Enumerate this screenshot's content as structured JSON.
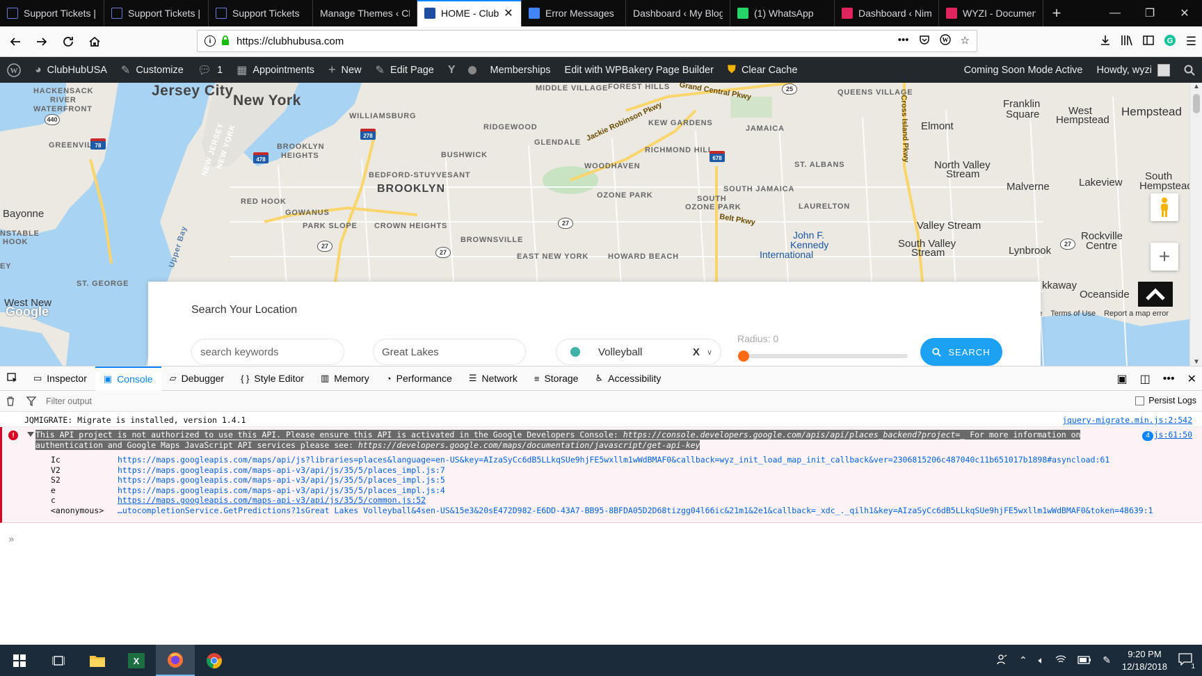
{
  "browser": {
    "tabs": [
      {
        "label": "Support Tickets |",
        "icon": "table-icon",
        "color": "#6b7bd6"
      },
      {
        "label": "Support Tickets |",
        "icon": "table-icon",
        "color": "#6b7bd6"
      },
      {
        "label": "Support Tickets",
        "icon": "table-icon",
        "color": "#6b7bd6"
      },
      {
        "label": "Manage Themes ‹ Cl",
        "icon": "",
        "color": ""
      },
      {
        "label": "HOME - Club",
        "icon": "clubhub-icon",
        "color": "#1d4ea0",
        "active": true
      },
      {
        "label": "Error Messages",
        "icon": "google-icon",
        "color": "#4285f4"
      },
      {
        "label": "Dashboard ‹ My Blog",
        "icon": "",
        "color": ""
      },
      {
        "label": "(1) WhatsApp",
        "icon": "whatsapp-icon",
        "color": "#25d366"
      },
      {
        "label": "Dashboard ‹ Nim",
        "icon": "wyzi-icon",
        "color": "#e0245e"
      },
      {
        "label": "WYZI - Documen",
        "icon": "wyzi-icon",
        "color": "#e0245e"
      }
    ],
    "new_tab": "+",
    "window": {
      "minimize": "—",
      "restore": "❐",
      "close": "✕"
    },
    "url": "https://clubhubusa.com"
  },
  "wp_admin": {
    "site": "ClubHubUSA",
    "customize": "Customize",
    "comments": "1",
    "appointments": "Appointments",
    "new": "New",
    "edit_page": "Edit Page",
    "memberships": "Memberships",
    "wpbakery": "Edit with WPBakery Page Builder",
    "clear_cache": "Clear Cache",
    "coming_soon": "Coming Soon Mode Active",
    "howdy": "Howdy, wyzi"
  },
  "map": {
    "labels": {
      "jersey_city": "Jersey City",
      "new_york": "New York",
      "brooklyn": "BROOKLYN",
      "hackensack": "HACKENSACK",
      "river": "RIVER",
      "waterfront": "WATERFRONT",
      "greenville": "GREENVILLE",
      "williamsburg": "WILLIAMSBURG",
      "ridgewood": "RIDGEWOOD",
      "glendale": "GLENDALE",
      "bushwick": "BUSHWICK",
      "brooklyn_heights": "BROOKLYN",
      "heights": "HEIGHTS",
      "bed_stuy": "BEDFORD-STUYVESANT",
      "red_hook": "RED HOOK",
      "gowanus": "GOWANUS",
      "park_slope": "PARK SLOPE",
      "crown_heights": "CROWN HEIGHTS",
      "brownsville": "BROWNSVILLE",
      "east_new_york": "EAST NEW YORK",
      "howard_beach": "HOWARD BEACH",
      "ozone_park": "OZONE PARK",
      "south_ozone_park": "SOUTH",
      "south_ozone_park2": "OZONE PARK",
      "woodhaven": "WOODHAVEN",
      "richmond_hill": "RICHMOND HILL",
      "kew_gardens": "KEW GARDENS",
      "forest_hills": "FOREST HILLS",
      "middle_village": "MIDDLE VILLAGE",
      "queens_village": "QUEENS VILLAGE",
      "jamaica": "JAMAICA",
      "st_albans": "ST. ALBANS",
      "south_jamaica": "SOUTH JAMAICA",
      "laurelton": "LAURELTON",
      "franklin_square": "Franklin",
      "franklin_square2": "Square",
      "elmont": "Elmont",
      "west_hempstead": "West",
      "west_hempstead2": "Hempstead",
      "hempstead": "Hempstead",
      "north_valley_stream": "North Valley",
      "north_valley_stream2": "Stream",
      "malverne": "Malverne",
      "lakeview": "Lakeview",
      "south_hempstead": "South",
      "south_hempstead2": "Hempstead",
      "valley_stream": "Valley Stream",
      "south_valley_stream": "South Valley",
      "south_valley_stream2": "Stream",
      "lynbrook": "Lynbrook",
      "rockville_centre": "Rockville",
      "rockville_centre2": "Centre",
      "oceanside": "Oceanside",
      "kaway": "kkaway",
      "bayonne": "Bayonne",
      "constable": "NSTABLE",
      "hook": "HOOK",
      "st_george": "ST. GEORGE",
      "west_new": "West New",
      "jfk1": "John F.",
      "jfk2": "Kennedy",
      "jfk3": "International",
      "upper_bay": "Upper Bay",
      "nj_label": "NEW JERSEY",
      "ny_label": "NEW YORK",
      "grand_central": "Grand Central Pkwy",
      "jackie_robinson": "Jackie Robinson Pkwy",
      "belt_pkwy": "Belt Pkwy",
      "cross_island": "Cross Island Pkwy",
      "ey": "EY"
    },
    "shields": {
      "s440": "440",
      "s78": "78",
      "s278": "278",
      "s478": "478",
      "s678": "678",
      "s25": "25",
      "s27a": "27",
      "s27b": "27",
      "s27c": "27",
      "s27d": "27"
    },
    "footer": {
      "e": "e",
      "terms": "Terms of Use",
      "report": "Report a map error"
    },
    "google": "Google"
  },
  "search": {
    "title": "Search Your Location",
    "keywords_placeholder": "search keywords",
    "location_value": "Great Lakes",
    "category_value": "Volleyball",
    "category_clear": "X",
    "radius_label": "Radius: 0",
    "radius_value": 0,
    "button": "SEARCH"
  },
  "devtools": {
    "tabs": [
      "Inspector",
      "Console",
      "Debugger",
      "Style Editor",
      "Memory",
      "Performance",
      "Network",
      "Storage",
      "Accessibility"
    ],
    "active_tab": "Console",
    "filter_placeholder": "Filter output",
    "persist_logs": "Persist Logs",
    "messages": {
      "log_text": "JQMIGRATE: Migrate is installed, version 1.4.1",
      "log_source": "jquery-migrate.min.js:2:542",
      "error_line1_a": "This API project is not authorized to use this API. Please ensure this API is activated in the Google Developers Console: ",
      "error_line1_link": "https://console.developers.google.com/apis/api/places_backend?project=_",
      "error_line1_b": " For more information on",
      "error_line2_a": "authentication and Google Maps JavaScript API services please see: ",
      "error_line2_link": "https://developers.google.com/maps/documentation/javascript/get-api-key",
      "error_count": "4",
      "error_source": "js:61:50",
      "stack": [
        {
          "fn": "Ic",
          "loc": "https://maps.googleapis.com/maps/api/js?libraries=places&language=en-US&key=AIzaSyCc6dB5LLkqSUe9hjFE5wxllm1wWdBMAF0&callback=wyz_init_load_map_init_callback&ver=2306815206c487040c11b651017b1898#asyncload:61"
        },
        {
          "fn": "V2",
          "loc": "https://maps.googleapis.com/maps-api-v3/api/js/35/5/places_impl.js:7"
        },
        {
          "fn": "S2",
          "loc": "https://maps.googleapis.com/maps-api-v3/api/js/35/5/places_impl.js:5"
        },
        {
          "fn": "e",
          "loc": "https://maps.googleapis.com/maps-api-v3/api/js/35/5/places_impl.js:4"
        },
        {
          "fn": "c",
          "loc": "https://maps.googleapis.com/maps-api-v3/api/js/35/5/common.js:52"
        },
        {
          "fn": "<anonymous>",
          "loc": "…utocompletionService.GetPredictions?1sGreat Lakes Volleyball&4sen-US&15e3&20sE472D982-E6DD-43A7-BB95-8BFDA05D2D68tizgg04l66ic&21m1&2e1&callback=_xdc_._qilh1&key=AIzaSyCc6dB5LLkqSUe9hjFE5wxllm1wWdBMAF0&token=48639:1"
        }
      ]
    },
    "prompt": "»"
  },
  "taskbar": {
    "time": "9:20 PM",
    "date": "12/18/2018",
    "notifications": "1"
  },
  "colors": {
    "accent": "#0a84ff",
    "wp_bar": "#23282d",
    "search_button": "#1da1f2",
    "radius_thumb": "#ff6a13",
    "error_bg": "#fdf2f5"
  }
}
